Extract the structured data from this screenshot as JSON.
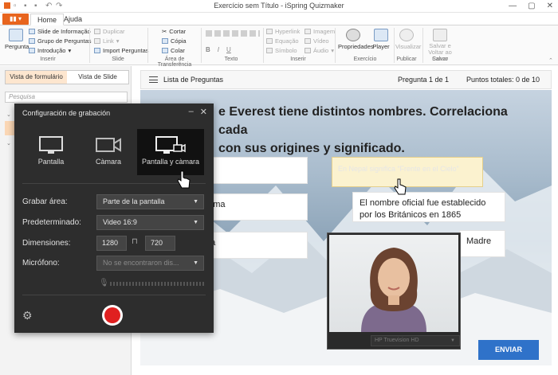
{
  "app": {
    "title": "Exercício sem Título - iSpring Quizmaker",
    "tabs": [
      "Home",
      "Ajuda"
    ],
    "file_label": "▮▮ ▾"
  },
  "ribbon": {
    "pergunta": "Pergunta",
    "slide_de_informacao": "Slide de Informação",
    "grupo_de_perguntas": "Grupo de Perguntas",
    "introducao": "Introdução",
    "duplicar": "Duplicar",
    "link": "Link",
    "import_perguntas": "Import Perguntas",
    "cortar": "Cortar",
    "copia": "Cópia",
    "colar": "Colar",
    "hyperlink": "Hyperlink",
    "equacao": "Equação",
    "simbolo": "Símbolo",
    "imagem": "Imagem",
    "video": "Vídeo",
    "audio": "Áudio",
    "propriedades": "Propriedades",
    "player": "Player",
    "visualizar": "Visualizar",
    "salvar_voltar": "Salvar e Voltar ao Curso",
    "groups": {
      "inserir1": "Inserir",
      "slide": "Slide",
      "area": "Área de Transferência",
      "texto": "Texto",
      "inserir2": "Inserir",
      "exercicio": "Exercício",
      "publicar": "Publicar",
      "salvar": "Salvar"
    },
    "text_format": [
      "B",
      "I",
      "U"
    ]
  },
  "left_panel": {
    "view_form": "Vista de formulário",
    "view_slide": "Vista de Slide",
    "search_placeholder": "Pesquisa"
  },
  "stage": {
    "list_label": "Lista de Preguntas",
    "question_counter": "Pregunta 1 de 1",
    "points": "Puntos totales: 0 de 10",
    "question_text": "e Everest tiene distintos nombres. Correlaciona cada\ncon sus origines y significado.",
    "left_items": [
      "",
      "ngma",
      "tha"
    ],
    "right_items": [
      "En Nepal significa “Frente en el Cielo”",
      "El nombre oficial fue establecido por los Británicos en 1865",
      "Madre"
    ],
    "send_button": "ENVIAR"
  },
  "webcam": {
    "device": "HP Truevision HD"
  },
  "recording_dialog": {
    "title": "Configuración de grabación",
    "modes": [
      "Pantalla",
      "Càmara",
      "Pantalla y càmara"
    ],
    "selected_mode": "Pantalla y càmara",
    "labels": {
      "area": "Grabar área:",
      "preset": "Predeterminado:",
      "dims": "Dimensiones:",
      "mic": "Micrófono:"
    },
    "values": {
      "area": "Parte de la pantalla",
      "preset": "Video 16:9",
      "width": "1280",
      "height": "720",
      "mic": "No se encontraron dis..."
    }
  }
}
